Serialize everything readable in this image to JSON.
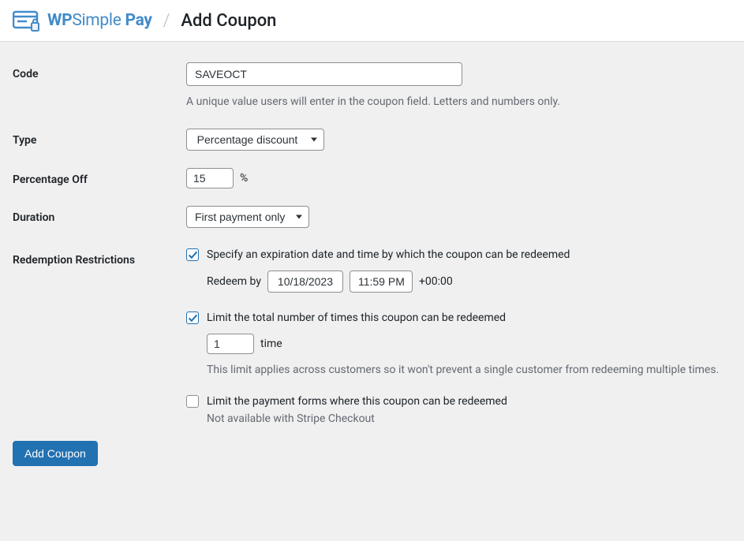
{
  "header": {
    "brand_wp": "WP",
    "brand_simple": "Simple",
    "brand_pay": "Pay",
    "divider": "/",
    "page_title": "Add Coupon"
  },
  "form": {
    "code": {
      "label": "Code",
      "value": "SAVEOCT",
      "help": "A unique value users will enter in the coupon field. Letters and numbers only."
    },
    "type": {
      "label": "Type",
      "selected": "Percentage discount"
    },
    "percentage": {
      "label": "Percentage Off",
      "value": "15",
      "suffix": "%"
    },
    "duration": {
      "label": "Duration",
      "selected": "First payment only"
    },
    "restrictions": {
      "label": "Redemption Restrictions",
      "expiration": {
        "checked": true,
        "text": "Specify an expiration date and time by which the coupon can be redeemed",
        "redeem_by_label": "Redeem by",
        "date": "10/18/2023",
        "time": "11:59 PM",
        "tz": "+00:00"
      },
      "limit_total": {
        "checked": true,
        "text": "Limit the total number of times this coupon can be redeemed",
        "value": "1",
        "suffix": "time",
        "help": "This limit applies across customers so it won't prevent a single customer from redeeming multiple times."
      },
      "limit_forms": {
        "checked": false,
        "text": "Limit the payment forms where this coupon can be redeemed",
        "note": "Not available with Stripe Checkout"
      }
    },
    "submit_label": "Add Coupon"
  }
}
